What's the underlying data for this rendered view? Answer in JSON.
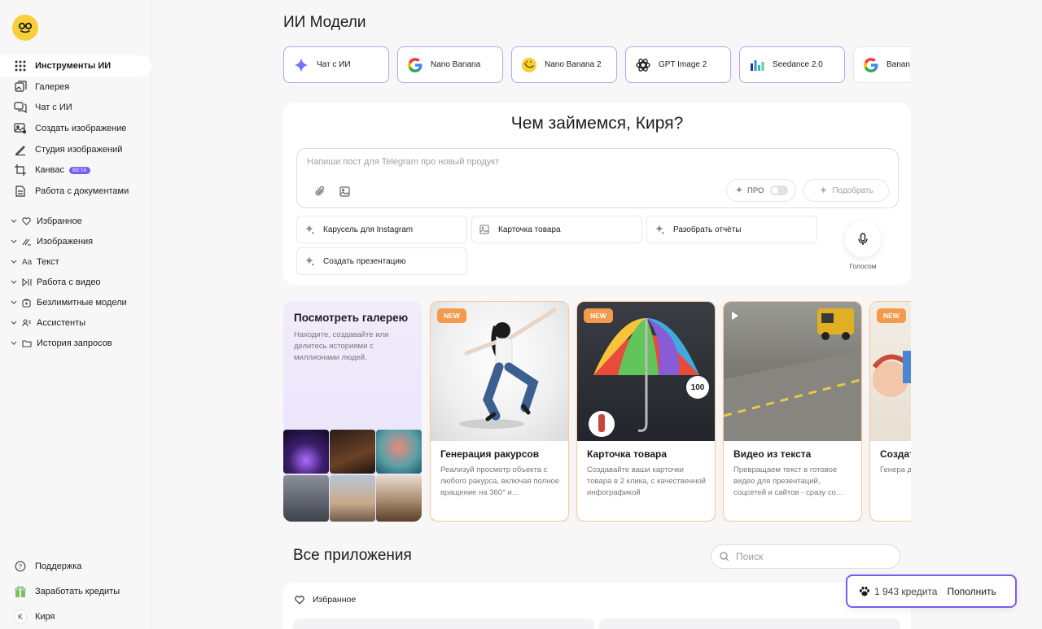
{
  "sidebar": {
    "nav": [
      {
        "label": "Инструменты ИИ",
        "icon": "grid-icon"
      },
      {
        "label": "Галерея",
        "icon": "gallery-icon"
      },
      {
        "label": "Чат с ИИ",
        "icon": "chat-icon"
      },
      {
        "label": "Создать изображение",
        "icon": "image-create-icon"
      },
      {
        "label": "Студия изображений",
        "icon": "pen-icon"
      },
      {
        "label": "Канвас",
        "icon": "crop-icon",
        "badge": "BETA"
      },
      {
        "label": "Работа с документами",
        "icon": "document-icon"
      }
    ],
    "groups": [
      {
        "label": "Избранное",
        "icon": "heart-icon"
      },
      {
        "label": "Изображения",
        "icon": "brush-icon"
      },
      {
        "label": "Текст",
        "icon": "text-icon"
      },
      {
        "label": "Работа с видео",
        "icon": "video-icon"
      },
      {
        "label": "Безлимитные модели",
        "icon": "unlimited-icon"
      },
      {
        "label": "Ассистенты",
        "icon": "assistants-icon"
      },
      {
        "label": "История запросов",
        "icon": "folder-icon"
      }
    ],
    "text_icon_glyph": "Aa",
    "bottom": [
      {
        "label": "Поддержка",
        "icon": "help-icon"
      },
      {
        "label": "Заработать кредиты",
        "icon": "gift-icon"
      },
      {
        "label": "Киря",
        "icon": "avatar",
        "initial": "K"
      }
    ]
  },
  "main": {
    "title": "ИИ Модели",
    "models": [
      {
        "label": "Чат с ИИ",
        "icon": "sparkle-icon"
      },
      {
        "label": "Nano Banana",
        "icon": "google-icon"
      },
      {
        "label": "Nano Banana 2",
        "icon": "banana-icon"
      },
      {
        "label": "GPT Image 2",
        "icon": "openai-icon"
      },
      {
        "label": "Seedance 2.0",
        "icon": "seedance-icon"
      },
      {
        "label": "Banana",
        "icon": "google-icon"
      }
    ],
    "hero": {
      "title": "Чем займемся, Киря?",
      "placeholder": "Напиши пост для Telegram про новый продукт",
      "pro_label": "ПРО",
      "pick_label": "Подобрать",
      "suggestions": [
        {
          "label": "Карусель для Instagram",
          "icon": "sparkle-icon"
        },
        {
          "label": "Карточка товара",
          "icon": "image-icon"
        },
        {
          "label": "Разобрать отчёты",
          "icon": "sparkle-icon"
        },
        {
          "label": "Создать презентацию",
          "icon": "sparkle-icon"
        }
      ],
      "mic_label": "Голосом"
    },
    "gallery": {
      "title": "Посмотреть галерею",
      "description": "Находите, создавайте или делитесь историями с миллионами людей.",
      "cards": [
        {
          "title": "Генерация ракурсов",
          "description": "Реализуй просмотр объекта с любого ракурса, включая полное вращение на 360° и…",
          "badge": "NEW"
        },
        {
          "title": "Карточка товара",
          "description": "Создавайте ваши карточки товара в 2 клика, с качественной инфографикой",
          "badge": "NEW"
        },
        {
          "title": "Видео из текста",
          "description": "Превращаем текст в готовое видео для презентаций, соцсетей и сайтов - сразу со…",
          "badge": ""
        },
        {
          "title": "Создать",
          "description": "Генера для про переда",
          "badge": "NEW"
        }
      ]
    },
    "apps": {
      "title": "Все приложения",
      "search_placeholder": "Поиск",
      "favorites_label": "Избранное"
    }
  },
  "credits": {
    "amount": "1 943 кредита",
    "topup": "Пополнить"
  },
  "colors": {
    "accent": "#7c5cf0",
    "chip_border": "#b9a6ec",
    "badge": "#f39a4c",
    "logo": "#f6cf3a"
  }
}
